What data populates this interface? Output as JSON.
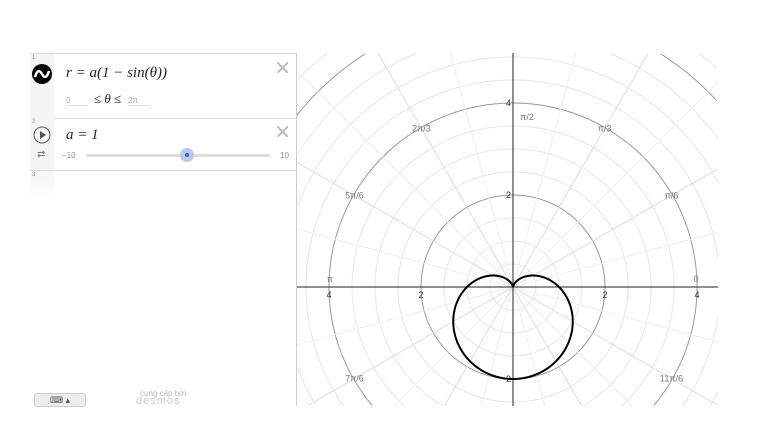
{
  "expressions": [
    {
      "number": "1",
      "formula": "r = a(1 − sin(θ))",
      "domain_min": "0",
      "domain_op": "≤ θ ≤",
      "domain_max": "2π",
      "color": "#000000"
    },
    {
      "number": "2",
      "formula": "a = 1",
      "slider_min": "−10",
      "slider_max": "10",
      "slider_value": 1,
      "slider_range": [
        -10,
        10
      ]
    },
    {
      "number": "3"
    }
  ],
  "footer": {
    "powered_by": "cung cấp bởi",
    "brand": "desmos"
  },
  "graph": {
    "x_ticks": [
      "4",
      "2",
      "2",
      "4"
    ],
    "y_ticks": [
      "4",
      "2",
      "-2"
    ],
    "angle_labels": [
      "0",
      "π/6",
      "π/3",
      "π/2",
      "2π/3",
      "5π/6",
      "π",
      "7π/6",
      "11π/6"
    ],
    "curve": "cardioid r=1-sin(θ)"
  }
}
